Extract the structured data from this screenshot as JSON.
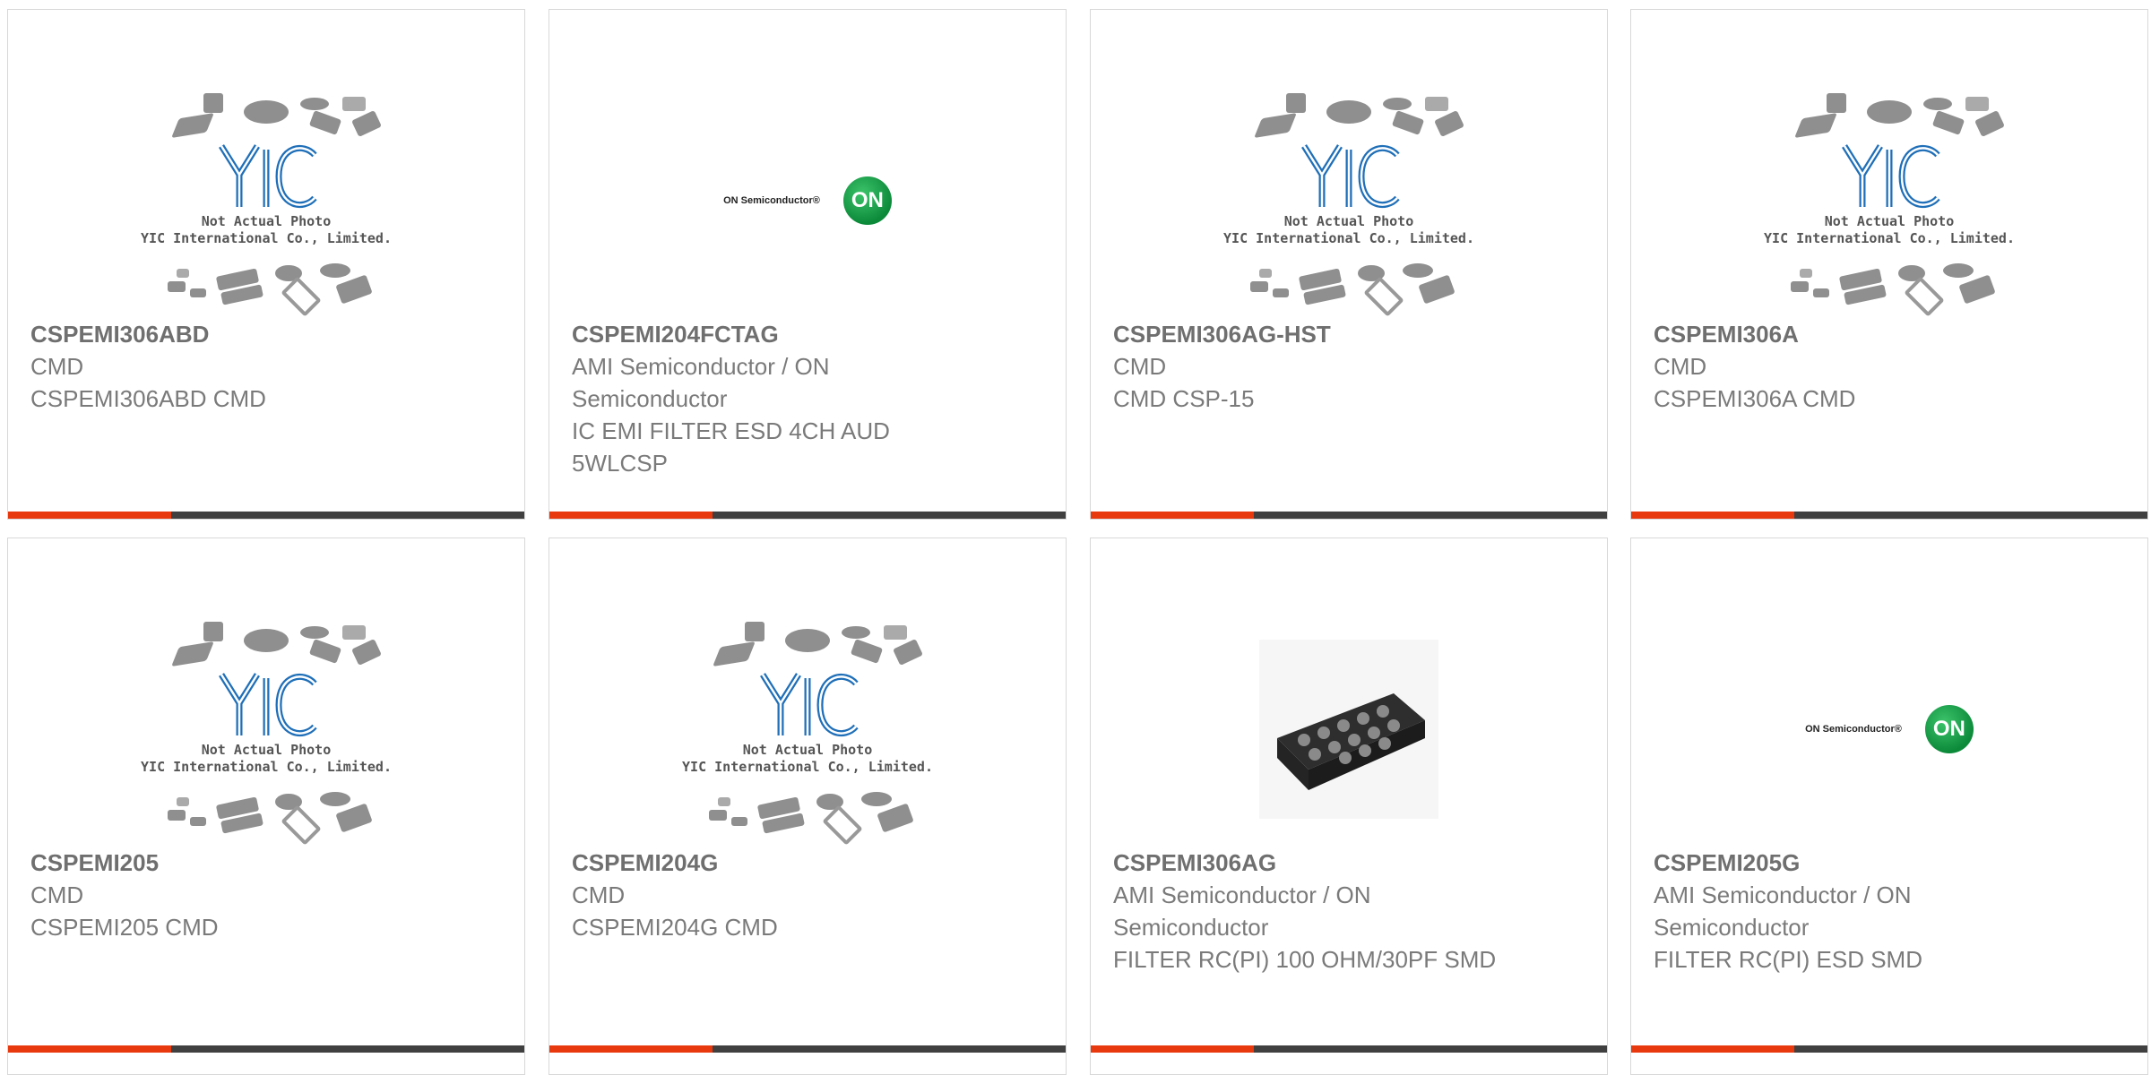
{
  "products": [
    {
      "part": "CSPEMI306ABD",
      "mfr": "CMD",
      "desc": "CSPEMI306ABD CMD",
      "image": "yic-placeholder",
      "image_text": [
        "Not Actual Photo",
        "YIC International Co., Limited."
      ]
    },
    {
      "part": "CSPEMI204FCTAG",
      "mfr": "AMI Semiconductor / ON Semiconductor",
      "desc": "IC EMI FILTER ESD 4CH AUD 5WLCSP",
      "image": "on-semi-logo",
      "image_text": [
        "ON Semiconductor®",
        "ON"
      ]
    },
    {
      "part": "CSPEMI306AG-HST",
      "mfr": "CMD",
      "desc": "CMD CSP-15",
      "image": "yic-placeholder",
      "image_text": [
        "Not Actual Photo",
        "YIC International Co., Limited."
      ]
    },
    {
      "part": "CSPEMI306A",
      "mfr": "CMD",
      "desc": "CSPEMI306A CMD",
      "image": "yic-placeholder",
      "image_text": [
        "Not Actual Photo",
        "YIC International Co., Limited."
      ]
    },
    {
      "part": "CSPEMI205",
      "mfr": "CMD",
      "desc": "CSPEMI205 CMD",
      "image": "yic-placeholder",
      "image_text": [
        "Not Actual Photo",
        "YIC International Co., Limited."
      ]
    },
    {
      "part": "CSPEMI204G",
      "mfr": "CMD",
      "desc": "CSPEMI204G CMD",
      "image": "yic-placeholder",
      "image_text": [
        "Not Actual Photo",
        "YIC International Co., Limited."
      ]
    },
    {
      "part": "CSPEMI306AG",
      "mfr": "AMI Semiconductor / ON Semiconductor",
      "desc": "FILTER RC(PI) 100 OHM/30PF SMD",
      "image": "chip-photo"
    },
    {
      "part": "CSPEMI205G",
      "mfr": "AMI Semiconductor / ON Semiconductor",
      "desc": "FILTER RC(PI) ESD SMD",
      "image": "on-semi-logo",
      "image_text": [
        "ON Semiconductor®",
        "ON"
      ]
    }
  ],
  "colors": {
    "accent": "#e8380d",
    "bar": "#404040",
    "text": "#7a7a7a",
    "yic_blue": "#1f6fb8",
    "on_green": "#0c8a3a"
  }
}
